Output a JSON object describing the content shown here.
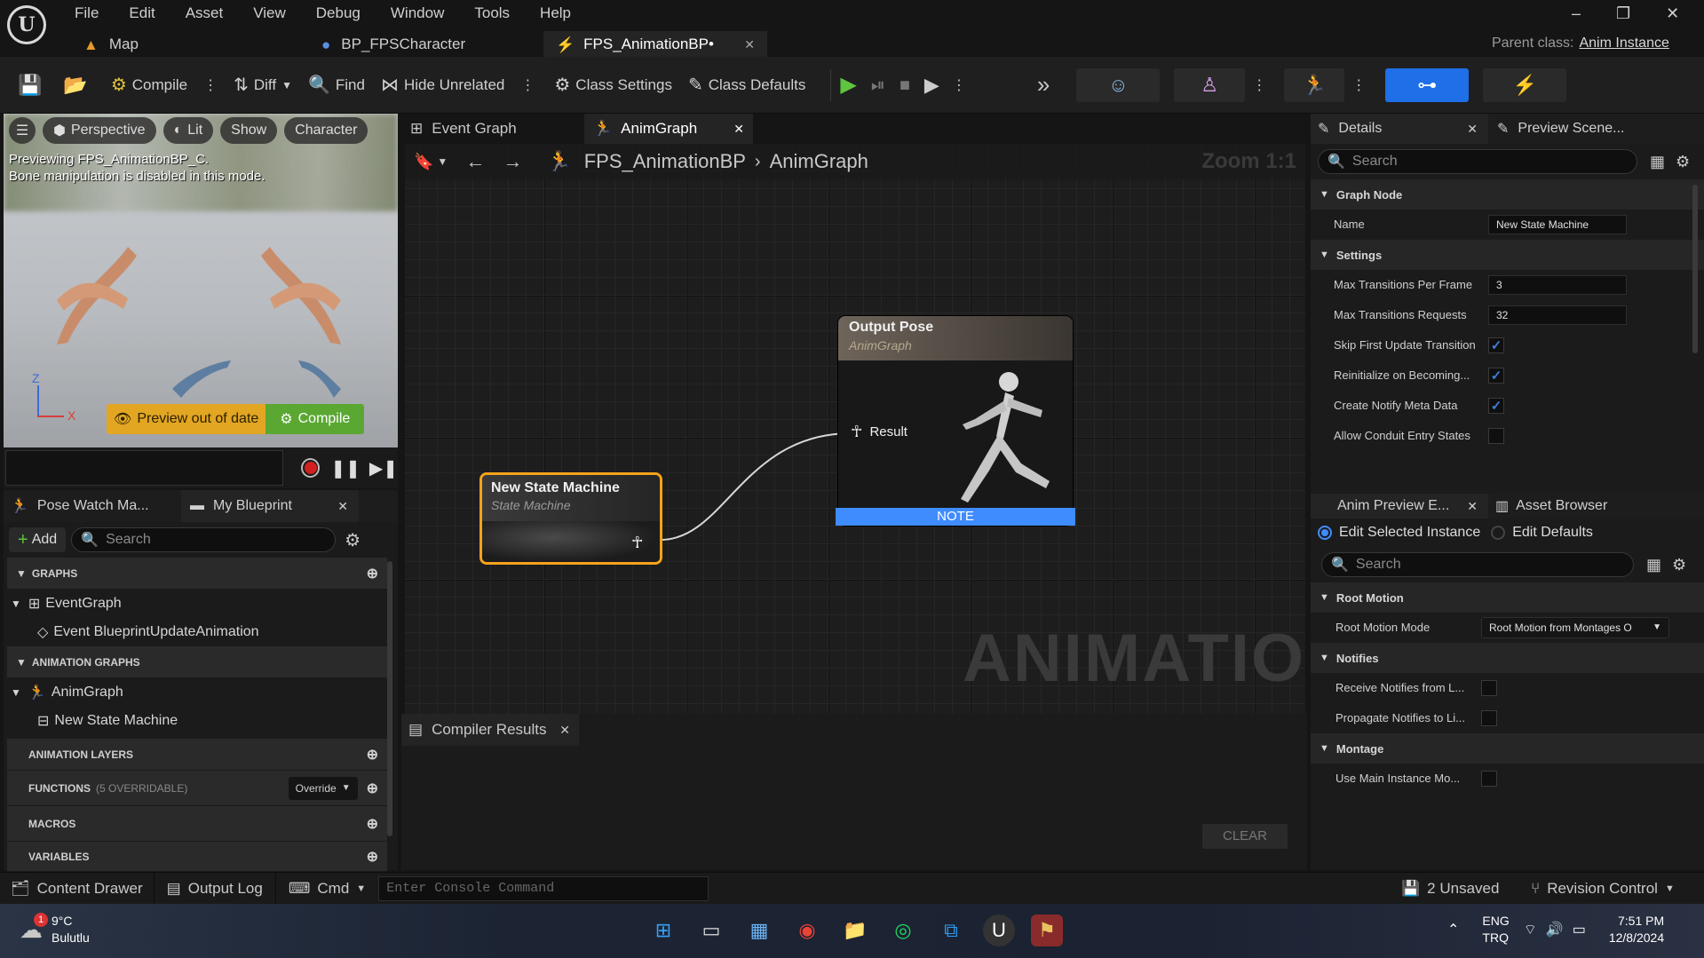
{
  "title_bar": {
    "menus": [
      "File",
      "Edit",
      "Asset",
      "View",
      "Debug",
      "Window",
      "Tools",
      "Help"
    ],
    "tabs": [
      {
        "label": "Map"
      },
      {
        "label": "BP_FPSCharacter"
      },
      {
        "label": "FPS_AnimationBP•"
      }
    ],
    "parent_class_label": "Parent class:",
    "parent_class_value": "Anim Instance"
  },
  "toolbar": {
    "compile": "Compile",
    "diff": "Diff",
    "find": "Find",
    "hide_unrelated": "Hide Unrelated",
    "class_settings": "Class Settings",
    "class_defaults": "Class Defaults"
  },
  "viewport": {
    "perspective": "Perspective",
    "lit": "Lit",
    "show": "Show",
    "character": "Character",
    "message_line1": "Previewing FPS_AnimationBP_C.",
    "message_line2": "Bone manipulation is disabled in this mode.",
    "preview_out_of_date": "Preview out of date",
    "compile": "Compile",
    "axis_z": "Z",
    "axis_x": "X"
  },
  "my_blueprint": {
    "tab_pose_watch": "Pose Watch Ma...",
    "tab_my_blueprint": "My Blueprint",
    "add": "Add",
    "search_placeholder": "Search",
    "graphs_header": "GRAPHS",
    "event_graph": "EventGraph",
    "event_update": "Event BlueprintUpdateAnimation",
    "anim_graphs_header": "ANIMATION GRAPHS",
    "anim_graph": "AnimGraph",
    "new_state_machine": "New State Machine",
    "anim_layers_header": "ANIMATION LAYERS",
    "functions_header": "FUNCTIONS",
    "functions_sub": "(5 OVERRIDABLE)",
    "override": "Override",
    "macros_header": "MACROS",
    "variables_header": "VARIABLES"
  },
  "graph": {
    "tab_event_graph": "Event Graph",
    "tab_anim_graph": "AnimGraph",
    "breadcrumb_root": "FPS_AnimationBP",
    "breadcrumb_leaf": "AnimGraph",
    "zoom": "Zoom 1:1",
    "watermark": "ANIMATION",
    "state_node_title": "New State Machine",
    "state_node_sub": "State Machine",
    "output_node_title": "Output Pose",
    "output_node_sub": "AnimGraph",
    "output_pin": "Result",
    "note": "NOTE"
  },
  "compiler": {
    "tab": "Compiler Results",
    "clear": "CLEAR"
  },
  "details": {
    "tab_details": "Details",
    "tab_preview": "Preview Scene...",
    "search_placeholder": "Search",
    "sec_graph_node": "Graph Node",
    "name_label": "Name",
    "name_value": "New State Machine",
    "sec_settings": "Settings",
    "max_trans_frame_label": "Max Transitions Per Frame",
    "max_trans_frame_value": "3",
    "max_trans_req_label": "Max Transitions Requests",
    "max_trans_req_value": "32",
    "skip_first_label": "Skip First Update Transition",
    "skip_first_checked": true,
    "reinit_label": "Reinitialize on Becoming...",
    "reinit_checked": true,
    "notify_meta_label": "Create Notify Meta Data",
    "notify_meta_checked": true,
    "allow_conduit_label": "Allow Conduit Entry States",
    "allow_conduit_checked": false
  },
  "anim_preview": {
    "tab_anim_preview": "Anim Preview E...",
    "tab_asset_browser": "Asset Browser",
    "edit_selected": "Edit Selected Instance",
    "edit_defaults": "Edit Defaults",
    "search_placeholder": "Search",
    "sec_root_motion": "Root Motion",
    "root_motion_mode_label": "Root Motion Mode",
    "root_motion_mode_value": "Root Motion from Montages O",
    "sec_notifies": "Notifies",
    "receive_notifies_label": "Receive Notifies from L...",
    "propagate_notifies_label": "Propagate Notifies to Li...",
    "sec_montage": "Montage",
    "use_main_label": "Use Main Instance Mo..."
  },
  "status_bar": {
    "content_drawer": "Content Drawer",
    "output_log": "Output Log",
    "cmd": "Cmd",
    "console_placeholder": "Enter Console Command",
    "unsaved": "2 Unsaved",
    "revision_control": "Revision Control"
  },
  "taskbar": {
    "weather_temp": "9°C",
    "weather_desc": "Bulutlu",
    "weather_badge": "1",
    "lang1": "ENG",
    "lang2": "TRQ",
    "time": "7:51 PM",
    "date": "12/8/2024"
  },
  "colors": {
    "accent_blue": "#3f8cff",
    "node_orange": "#f7a21b",
    "play_green": "#5fc43f",
    "compile_green": "#5aa832",
    "preview_yellow": "#e2a623"
  }
}
